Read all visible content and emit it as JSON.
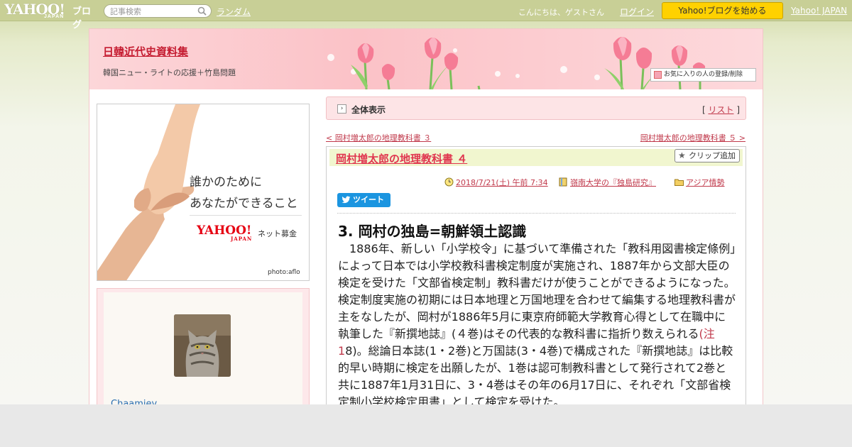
{
  "topbar": {
    "logo_main": "YAHOO!",
    "logo_sub": "JAPAN",
    "logo_blog": "ブログ",
    "search_placeholder": "記事検索",
    "random_link": "ランダム",
    "greeting": "こんにちは、ゲストさん",
    "login_link": "ログイン",
    "start_button": "Yahoo!ブログを始める",
    "yahoo_japan_link": "Yahoo! JAPAN"
  },
  "header": {
    "blog_title": "日韓近代史資料集",
    "blog_subtitle": "韓国ニュー・ライトの応援＋竹島問題",
    "favorite_button": "お気に入りの人の登録/削除"
  },
  "ad": {
    "line1": "誰かのために",
    "line2": "あなたができること",
    "logo": "YAHOO!",
    "logo_sub": "JAPAN",
    "service": "ネット募金",
    "credit": "photo:aflo"
  },
  "profile": {
    "name": "Chaamiey"
  },
  "main": {
    "view_all_label": "全体表示",
    "list_prefix": "[",
    "list_link": "リスト",
    "list_suffix": "]",
    "prev_link": "< 岡村増太郎の地理教科書 ３",
    "next_link": "岡村増太郎の地理教科書 ５ >",
    "article_title": "岡村増太郎の地理教科書 ４",
    "clip_button": "クリップ追加",
    "date": "2018/7/21(土) 午前 7:34",
    "category1": "嶺南大学の『独島研究』",
    "category2": "アジア情勢",
    "tweet_button": "ツイート",
    "section_heading": "3. 岡村の独島=朝鮮領土認識",
    "paragraph_a": "　1886年、新しい「小学校令」に基づいて準備された「教科用図書検定條例」によって日本では小学校教科書検定制度が実施され、1887年から文部大臣の検定を受けた「文部省検定制」教科書だけが使うことができるようになった。検定制度実施の初期には日本地理と万国地理を合わせて編集する地理教科書が主をなしたが、岡村が1886年5月に東京府師範大学教育心得として在職中に執筆した『新撰地誌』(４巻)はその代表的な教科書に指折り数えられる",
    "paragraph_note": "(注1",
    "paragraph_b": "8)。総論日本誌(1・2巻)と万国誌(3・4巻)で構成された『新撰地誌』は比較的早い時期に検定を出願したが、1巻は認可制教科書として発行されて2巻と共に1887年1月31日に、3・4巻はその年の6月17日に、それぞれ「文部省検定制小学校検定用書」として検定を受けた。"
  },
  "colors": {
    "topbar": "#c8cf96",
    "accent_red": "#c51c31",
    "start_button": "#ffd100",
    "header_pink": "#fbc2c7",
    "article_head": "#f1f6cf"
  }
}
